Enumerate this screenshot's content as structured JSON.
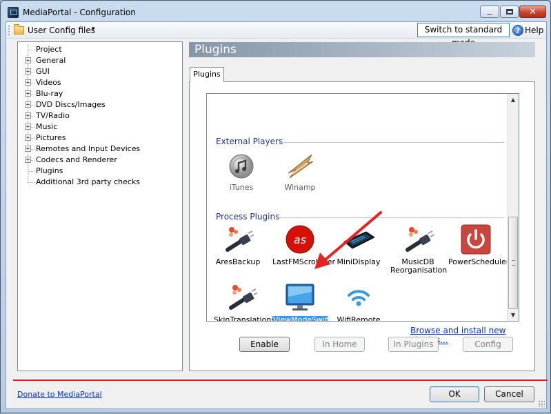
{
  "window": {
    "title": "MediaPortal - Configuration",
    "minimize_glyph": "",
    "maximize_glyph": "",
    "close_glyph": "✕"
  },
  "toolbar": {
    "user_config_label": "User Config files",
    "dropdown_glyph": "▾",
    "standard_mode_label": "Switch to standard mode",
    "help_glyph": "?",
    "help_label": "Help"
  },
  "tree": {
    "items": [
      {
        "label": "Project",
        "expandable": false
      },
      {
        "label": "General",
        "expandable": true
      },
      {
        "label": "GUI",
        "expandable": true
      },
      {
        "label": "Videos",
        "expandable": true
      },
      {
        "label": "Blu-ray",
        "expandable": true
      },
      {
        "label": "DVD Discs/Images",
        "expandable": true
      },
      {
        "label": "TV/Radio",
        "expandable": true
      },
      {
        "label": "Music",
        "expandable": true
      },
      {
        "label": "Pictures",
        "expandable": true
      },
      {
        "label": "Remotes and Input Devices",
        "expandable": true
      },
      {
        "label": "Codecs and Renderer",
        "expandable": true
      },
      {
        "label": "Plugins",
        "expandable": false
      },
      {
        "label": "Additional 3rd party checks",
        "expandable": false
      }
    ],
    "expander_glyph": "+"
  },
  "main": {
    "header": "Plugins",
    "tab_label": "Plugins",
    "groups": {
      "external": {
        "title": "External Players",
        "plugins": [
          {
            "label": "iTunes"
          },
          {
            "label": "Winamp"
          }
        ]
      },
      "process": {
        "title": "Process Plugins",
        "plugins": [
          {
            "label": "AresBackup"
          },
          {
            "label": "LastFMScrobbler"
          },
          {
            "label": "MiniDisplay"
          },
          {
            "label": "MusicDB Reorganisation"
          },
          {
            "label": "PowerScheduler"
          },
          {
            "label": "SkinTranslations"
          },
          {
            "label": "ViewModeSwitcher"
          },
          {
            "label": "WifiRemote"
          }
        ]
      }
    },
    "scroll_up_glyph": "▲",
    "scroll_down_glyph": "▼",
    "browse_link": "Browse and install new plugins...",
    "buttons": {
      "enable": "Enable",
      "in_home": "In Home",
      "in_plugins": "In Plugins",
      "config": "Config"
    }
  },
  "footer": {
    "donate_link": "Donate to MediaPortal",
    "ok": "OK",
    "cancel": "Cancel"
  },
  "colors": {
    "accent_selection": "#3399ff",
    "separator": "#e31b1b",
    "arrow": "#e52421",
    "link": "#0033cc"
  }
}
